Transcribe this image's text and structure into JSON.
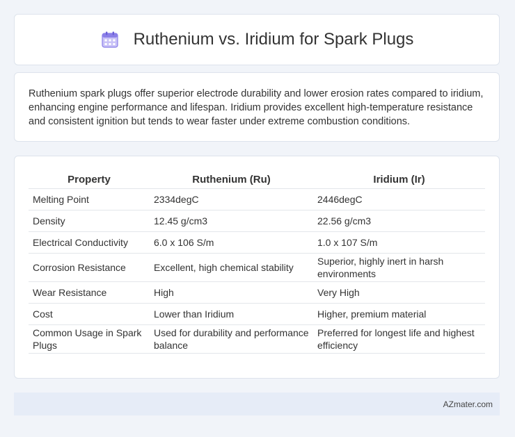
{
  "header": {
    "icon": "calendar-icon",
    "title": "Ruthenium vs. Iridium for Spark Plugs"
  },
  "summary": {
    "text": "Ruthenium spark plugs offer superior electrode durability and lower erosion rates compared to iridium, enhancing engine performance and lifespan. Iridium provides excellent high-temperature resistance and consistent ignition but tends to wear faster under extreme combustion conditions."
  },
  "table": {
    "headers": [
      "Property",
      "Ruthenium (Ru)",
      "Iridium (Ir)"
    ],
    "rows": [
      [
        "Melting Point",
        "2334degC",
        "2446degC"
      ],
      [
        "Density",
        "12.45 g/cm3",
        "22.56 g/cm3"
      ],
      [
        "Electrical Conductivity",
        "6.0 x 106 S/m",
        "1.0 x 107 S/m"
      ],
      [
        "Corrosion Resistance",
        "Excellent, high chemical stability",
        "Superior, highly inert in harsh environments"
      ],
      [
        "Wear Resistance",
        "High",
        "Very High"
      ],
      [
        "Cost",
        "Lower than Iridium",
        "Higher, premium material"
      ],
      [
        "Common Usage in Spark Plugs",
        "Used for durability and performance balance",
        "Preferred for longest life and highest efficiency"
      ]
    ]
  },
  "footer": {
    "source": "AZmater.com"
  },
  "colors": {
    "page_background": "#f1f4f9",
    "card_background": "#ffffff",
    "footer_background": "#e6ecf7",
    "icon_accent": "#8b7fe8"
  }
}
